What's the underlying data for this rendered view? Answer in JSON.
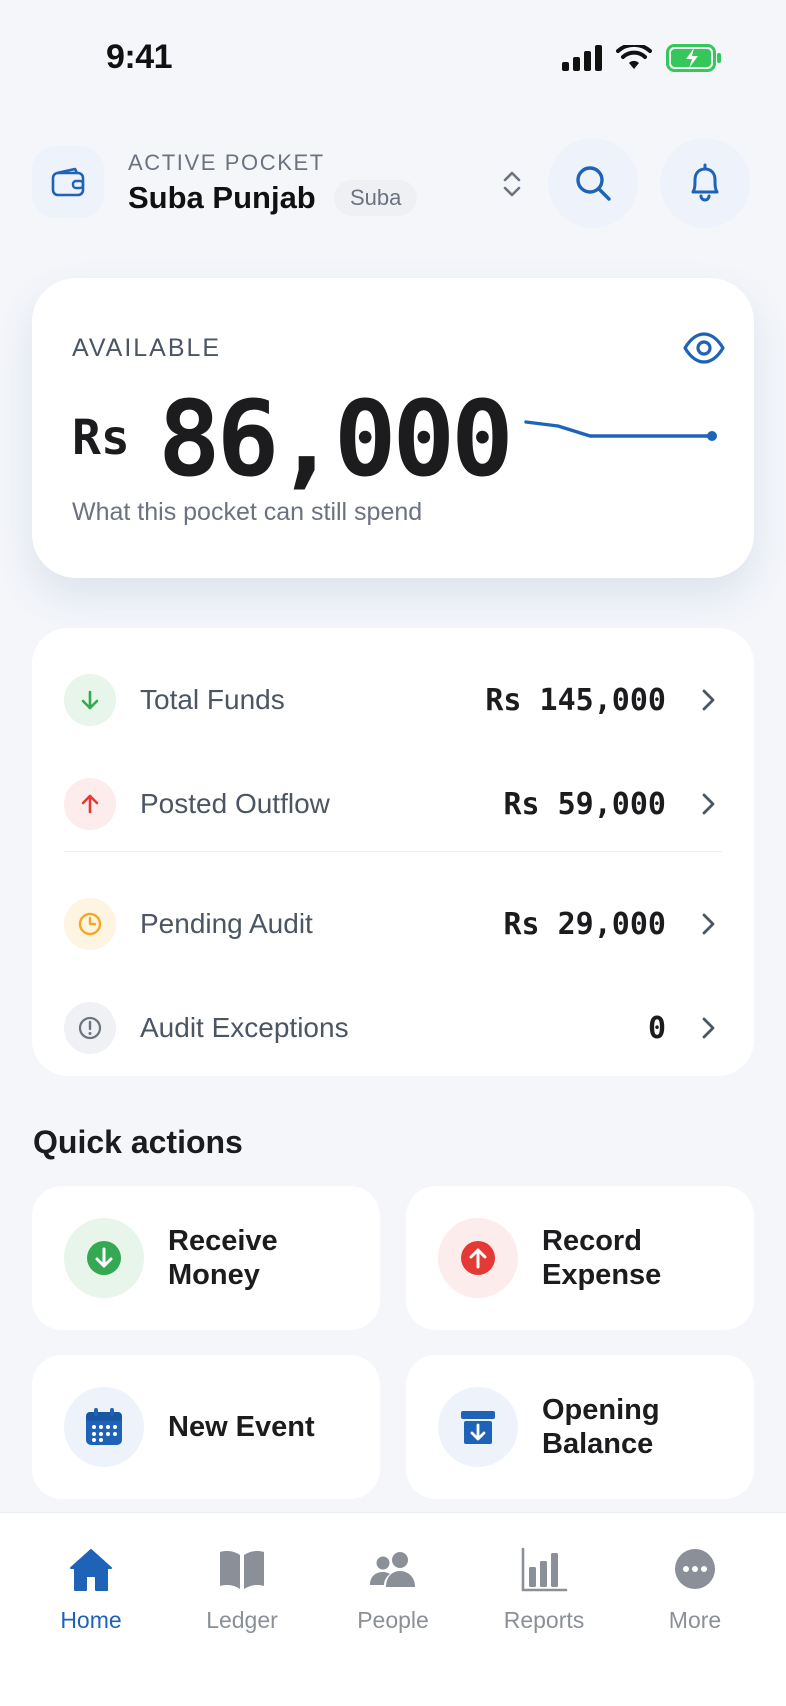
{
  "status": {
    "time": "9:41"
  },
  "header": {
    "pocket_label": "ACTIVE POCKET",
    "pocket_name": "Suba Punjab",
    "pocket_tag": "Suba"
  },
  "balance": {
    "label": "AVAILABLE",
    "currency": "Rs",
    "amount": "86,000",
    "caption": "What this pocket can still spend"
  },
  "summary": {
    "rows": [
      {
        "label": "Total Funds",
        "value": "Rs 145,000",
        "icon": "arrow-down-icon",
        "color": "#34a853"
      },
      {
        "label": "Posted Outflow",
        "value": "Rs 59,000",
        "icon": "arrow-up-icon",
        "color": "#e53935"
      },
      {
        "label": "Pending Audit",
        "value": "Rs 29,000",
        "icon": "clock-icon",
        "color": "#f5a623"
      },
      {
        "label": "Audit Exceptions",
        "value": "0",
        "icon": "alert-circle-icon",
        "color": "#6b7280"
      }
    ]
  },
  "quick_actions": {
    "title": "Quick actions",
    "items": [
      {
        "label": "Receive Money",
        "icon": "arrow-down-circle-icon"
      },
      {
        "label": "Record Expense",
        "icon": "arrow-up-circle-icon"
      },
      {
        "label": "New Event",
        "icon": "calendar-icon"
      },
      {
        "label": "Opening Balance",
        "icon": "archive-icon"
      }
    ]
  },
  "tabs": [
    {
      "label": "Home",
      "icon": "home-icon",
      "active": true
    },
    {
      "label": "Ledger",
      "icon": "book-icon",
      "active": false
    },
    {
      "label": "People",
      "icon": "people-icon",
      "active": false
    },
    {
      "label": "Reports",
      "icon": "bar-chart-icon",
      "active": false
    },
    {
      "label": "More",
      "icon": "more-icon",
      "active": false
    }
  ],
  "colors": {
    "accent": "#1e63b8",
    "background": "#f4f6fa",
    "success": "#34a853",
    "danger": "#e53935",
    "warning": "#f5a623"
  }
}
